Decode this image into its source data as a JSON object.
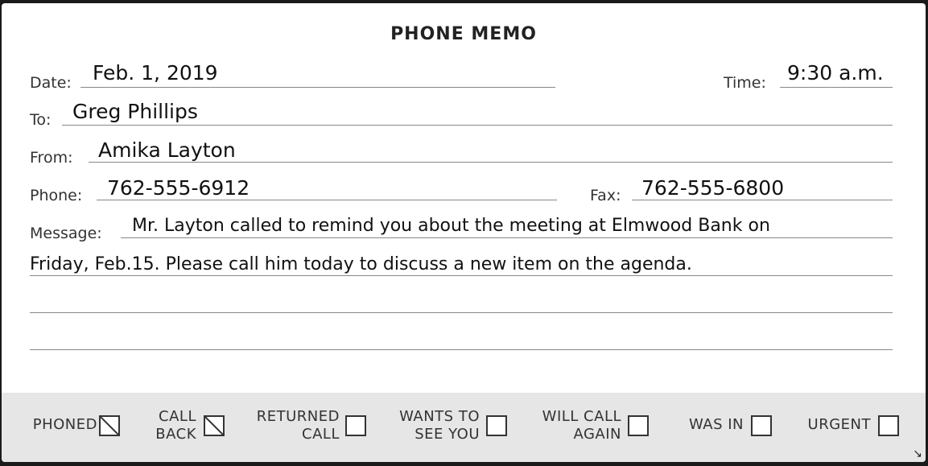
{
  "memo": {
    "title": "PHONE MEMO",
    "fields": {
      "date_label": "Date:",
      "date_value": "Feb. 1, 2019",
      "time_label": "Time:",
      "time_value": "9:30 a.m.",
      "to_label": "To:",
      "to_value": "Greg Phillips",
      "from_label": "From:",
      "from_value": "Amika Layton",
      "phone_label": "Phone:",
      "phone_value": "762-555-6912",
      "fax_label": "Fax:",
      "fax_value": "762-555-6800",
      "message_label": "Message:",
      "message_line1": "Mr. Layton called to remind you about the meeting at Elmwood Bank on",
      "message_line2": "Friday, Feb.15. Please call him today to discuss a new item on the agenda."
    },
    "checkboxes": [
      {
        "label_line1": "PHONED",
        "label_line2": "",
        "checked": true
      },
      {
        "label_line1": "CALL",
        "label_line2": "BACK",
        "checked": true
      },
      {
        "label_line1": "RETURNED",
        "label_line2": "CALL",
        "checked": false
      },
      {
        "label_line1": "WANTS TO",
        "label_line2": "SEE YOU",
        "checked": false
      },
      {
        "label_line1": "WILL CALL",
        "label_line2": "AGAIN",
        "checked": false
      },
      {
        "label_line1": "WAS IN",
        "label_line2": "",
        "checked": false
      },
      {
        "label_line1": "URGENT",
        "label_line2": "",
        "checked": false
      }
    ],
    "icons": {
      "resize": "resize-corner-icon"
    }
  }
}
